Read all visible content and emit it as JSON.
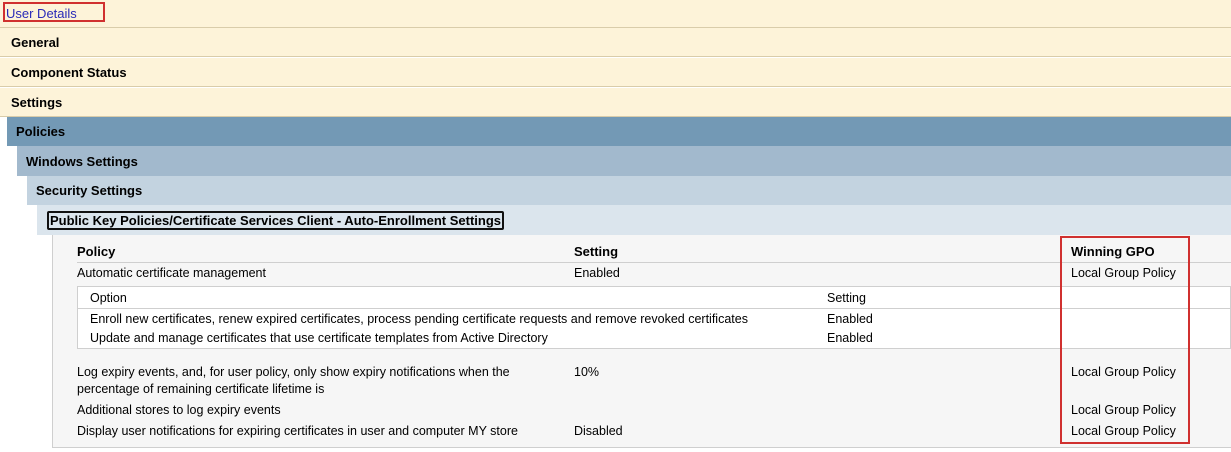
{
  "header": {
    "user_details": "User Details"
  },
  "sections": {
    "general": "General",
    "component_status": "Component Status",
    "settings": "Settings",
    "policies": "Policies",
    "windows_settings": "Windows Settings",
    "security_settings": "Security Settings",
    "pkp": "Public Key Policies/Certificate Services Client - Auto-Enrollment Settings"
  },
  "table": {
    "columns": [
      "Policy",
      "Setting",
      "Winning GPO"
    ],
    "rows": [
      {
        "policy": "Automatic certificate management",
        "setting": "Enabled",
        "gpo": "Local Group Policy"
      },
      {
        "policy_line1": "Log expiry events, and, for user policy, only show expiry notifications when the",
        "policy_line2": "percentage of remaining certificate lifetime is",
        "setting": "10%",
        "gpo": "Local Group Policy"
      },
      {
        "policy": "Additional stores to log expiry events",
        "setting": "",
        "gpo": "Local Group Policy"
      },
      {
        "policy": "Display user notifications for expiring certificates in user and computer MY store",
        "setting": "Disabled",
        "gpo": "Local Group Policy"
      }
    ],
    "sub": {
      "columns": [
        "Option",
        "Setting"
      ],
      "rows": [
        {
          "option": "Enroll new certificates, renew expired certificates, process pending certificate requests and remove revoked certificates",
          "setting": "Enabled"
        },
        {
          "option": "Update and manage certificates that use certificate templates from Active Directory",
          "setting": "Enabled"
        }
      ]
    }
  },
  "colors": {
    "tan": "#fdf3d9",
    "policies": "#7399b5",
    "windows": "#a2b9cd",
    "security": "#c3d3e0",
    "pkp": "#dbe5ed",
    "highlight": "#d0302f",
    "link": "#2a2ab8"
  }
}
